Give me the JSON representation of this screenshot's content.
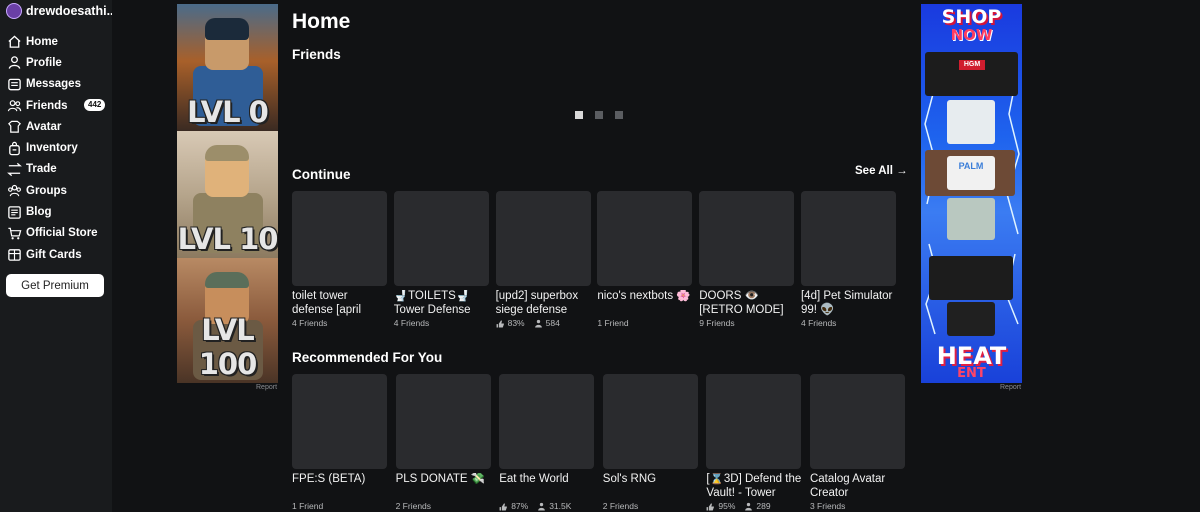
{
  "user": {
    "name": "drewdoesathi..."
  },
  "nav": [
    {
      "label": "Home",
      "icon": "home-icon"
    },
    {
      "label": "Profile",
      "icon": "profile-icon"
    },
    {
      "label": "Messages",
      "icon": "messages-icon"
    },
    {
      "label": "Friends",
      "icon": "friends-icon",
      "badge": "442"
    },
    {
      "label": "Avatar",
      "icon": "avatar-icon"
    },
    {
      "label": "Inventory",
      "icon": "inventory-icon"
    },
    {
      "label": "Trade",
      "icon": "trade-icon"
    },
    {
      "label": "Groups",
      "icon": "groups-icon"
    },
    {
      "label": "Blog",
      "icon": "blog-icon"
    },
    {
      "label": "Official Store",
      "icon": "store-icon"
    },
    {
      "label": "Gift Cards",
      "icon": "gift-card-icon"
    }
  ],
  "premium_button": "Get Premium",
  "ads": {
    "left": {
      "panels": [
        "LVL 0",
        "LVL 10",
        "LVL 100"
      ],
      "report": "Report"
    },
    "right": {
      "line1": "SHOP",
      "line2": "NOW",
      "shirt_label": "HGM",
      "shirt_label2": "PALM",
      "bottom1": "HEAT",
      "bottom2": "ENT",
      "report": "Report"
    }
  },
  "main": {
    "title": "Home",
    "friends_title": "Friends",
    "carousel_dots": 3,
    "continue_title": "Continue",
    "see_all": "See All →",
    "continue": [
      {
        "name": "toilet tower defense [april",
        "sub": "4 Friends"
      },
      {
        "name": "🚽TOILETS🚽 Tower Defense",
        "sub": "4 Friends"
      },
      {
        "name": "[upd2] superbox siege defense",
        "rating": "83%",
        "players": "584"
      },
      {
        "name": "nico's nextbots 🌸",
        "sub": "1 Friend"
      },
      {
        "name": "DOORS 👁️ [RETRO MODE]",
        "sub": "9 Friends"
      },
      {
        "name": "[4d] Pet Simulator 99! 👽",
        "sub": "4 Friends"
      }
    ],
    "recommended_title": "Recommended For You",
    "recommended": [
      {
        "name": "FPE:S (BETA)",
        "sub": "1 Friend"
      },
      {
        "name": "PLS DONATE 💸",
        "sub": "2 Friends"
      },
      {
        "name": "Eat the World",
        "rating": "87%",
        "players": "31.5K"
      },
      {
        "name": "Sol's RNG",
        "sub": "2 Friends"
      },
      {
        "name": "[⌛3D] Defend the Vault! - Tower",
        "rating": "95%",
        "players": "289"
      },
      {
        "name": "Catalog Avatar Creator",
        "sub": "3 Friends"
      }
    ]
  }
}
